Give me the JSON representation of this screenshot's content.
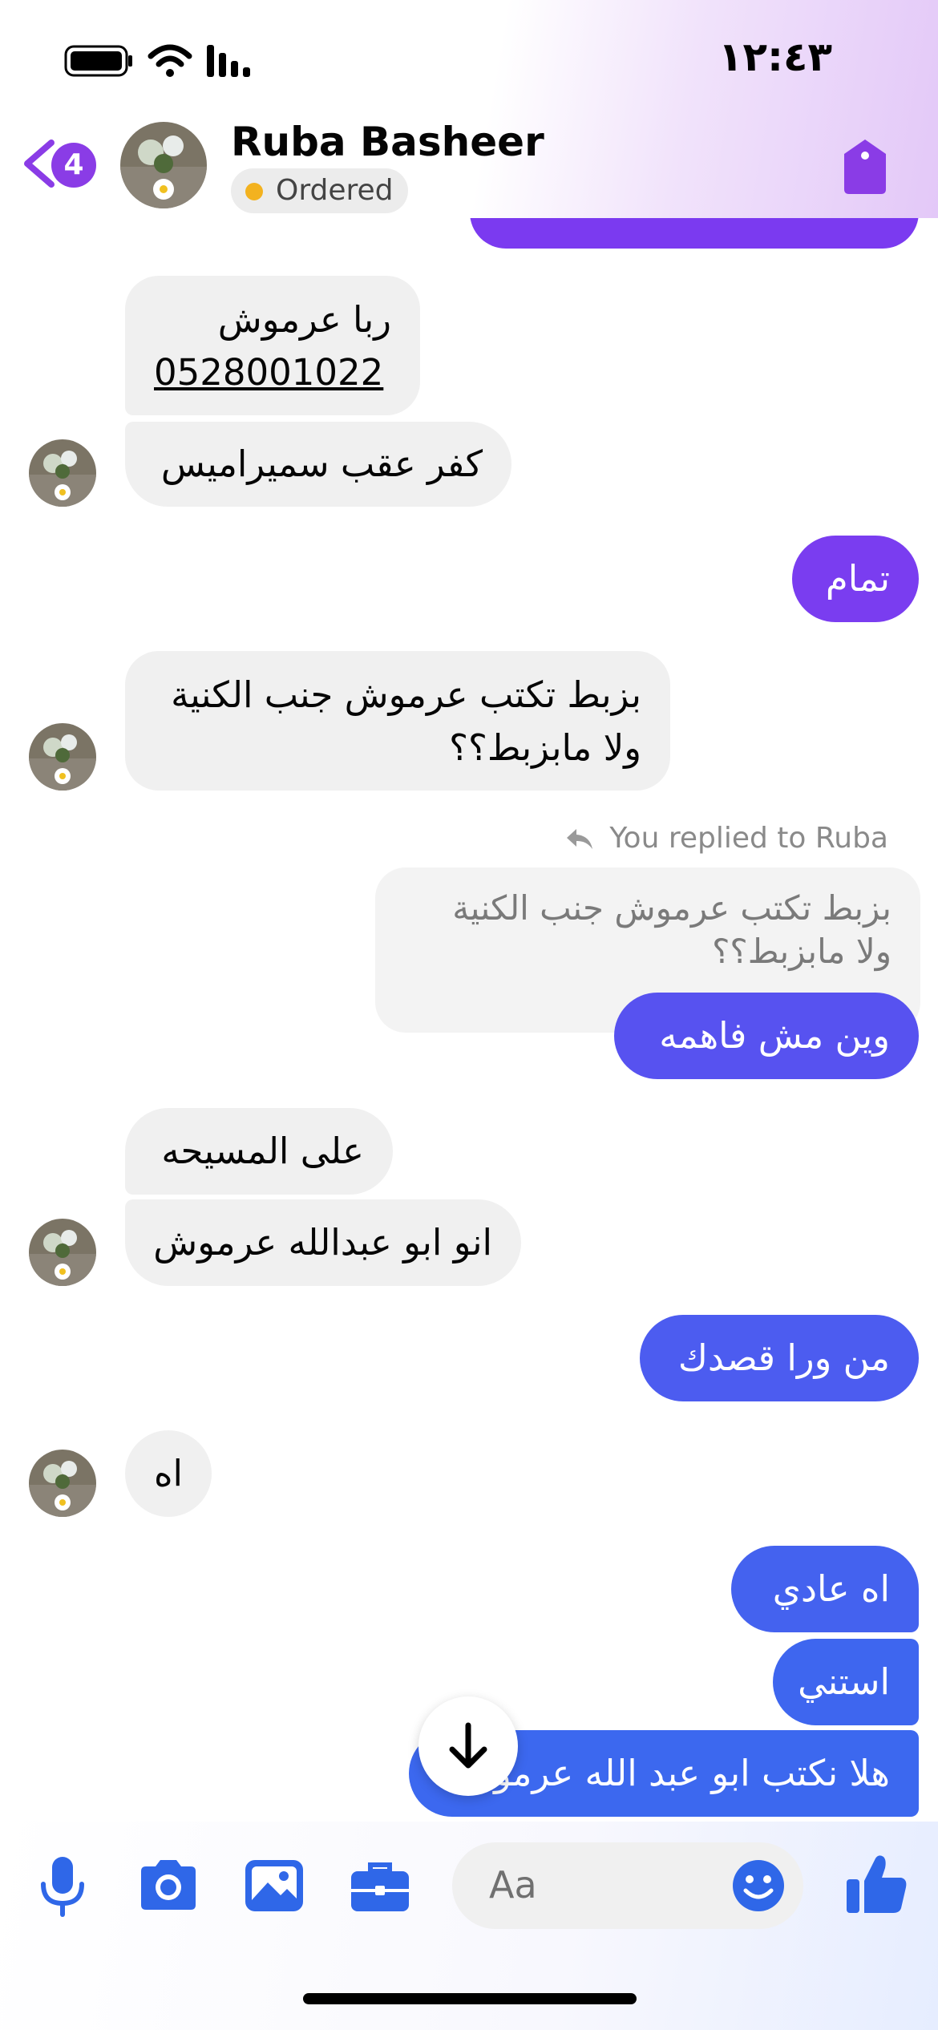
{
  "status_bar": {
    "time": "١٢:٤٣"
  },
  "header": {
    "unread_count": "4",
    "contact_name": "Ruba Basheer",
    "order_status": "Ordered"
  },
  "messages": {
    "m1_line1": "ربا عرموش",
    "m1_phone": "0528001022",
    "m2": "كفر عقب سميراميس",
    "m3": "تمام",
    "m4_line1": "بزبط تكتب عرموش جنب الكنية",
    "m4_line2": "ولا مابزبط؟؟",
    "reply_label": "You replied to Ruba",
    "quoted_line1": "بزبط تكتب عرموش جنب الكنية",
    "quoted_line2": "ولا مابزبط؟؟",
    "m5": "وين مش فاهمه",
    "m6": "على المسيحه",
    "m7": "انو ابو عبدالله عرموش",
    "m8": "من ورا قصدك",
    "m9": "اه",
    "m10": "اه عادي",
    "m11": "استني",
    "m12": "هلا نكتب ابو عبد الله عرموش"
  },
  "composer": {
    "placeholder": "Aa"
  },
  "colors": {
    "accent_purple": "#8a3ce6",
    "outgoing_top": "#7b3cf0",
    "outgoing_bottom": "#3f66ef",
    "incoming_bg": "#f0f0f0",
    "icon_blue": "#2f67e8"
  },
  "icons": [
    "back-chevron-icon",
    "shopping-tag-icon",
    "reply-arrow-icon",
    "arrow-down-icon",
    "microphone-icon",
    "camera-icon",
    "gallery-icon",
    "briefcase-icon",
    "emoji-icon",
    "thumbs-up-icon"
  ]
}
